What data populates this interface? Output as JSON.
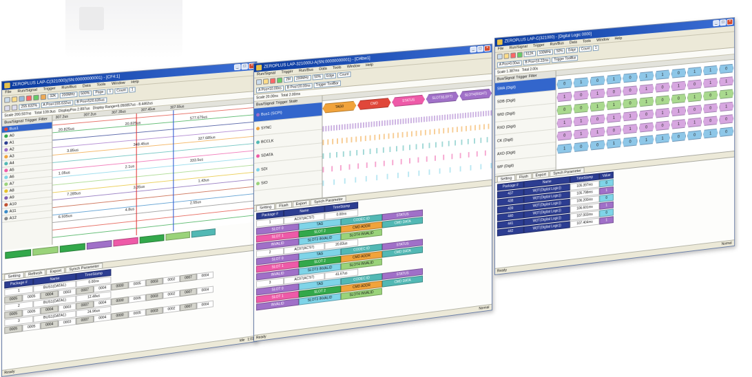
{
  "colors": {
    "title_bar": "#0a3a9e",
    "navy": "#2c3d91",
    "green": "#33a84b",
    "pink": "#ee5aa8",
    "purple": "#a070c8",
    "cyan": "#7fd4e8",
    "teal": "#52b8b4",
    "orange": "#f1a33b"
  },
  "window1": {
    "title": "ZEROPLUS LAP-C(321000)(SN:00000000001) - [CF4:1]",
    "menu": [
      "File",
      "Run/Signal",
      "Trigger",
      "Run/Bus",
      "Data",
      "Tools",
      "Window",
      "Help"
    ],
    "toolbar": {
      "memory": "32K",
      "clock": "200MHz",
      "zoom": "500%",
      "scale": "255.632%",
      "page": "Page",
      "page_value": "1",
      "count": "Count",
      "count_value": "1"
    },
    "info": {
      "scale": "Scale 200.937ns",
      "total": "Total 109.9us",
      "a_pos": "A Pos=155.632us",
      "b_pos": "B Pos=520.635us",
      "disp_pos": "DisplayPos 2.897us",
      "disp_range": "Display Range=6.050857us - 8.4462us"
    },
    "columns": {
      "bus_signal": "Bus/Signal",
      "trigger": "Trigger",
      "filter": "Filter"
    },
    "signals": [
      "Bus1",
      "A0",
      "A1",
      "A2",
      "A3",
      "A4",
      "A5",
      "A6",
      "A7",
      "A8",
      "A9",
      "A10",
      "A11",
      "A12"
    ],
    "timeline": [
      "307.2us",
      "307.2us",
      "307.35us",
      "307.45us",
      "307.55us"
    ],
    "measurements": [
      "20.825us",
      "20.825us",
      "577.675us",
      "3.85us",
      "348.45us",
      "327.685us",
      "1.05us",
      "2.1us",
      "333.5us",
      "7.285us",
      "3.35us",
      "1.43us",
      "6.935us",
      "4.8us",
      "2.55us"
    ],
    "tabs": [
      "Setting",
      "Refresh",
      "Export",
      "Synch Parameter"
    ],
    "packet_headers": [
      "Package #",
      "Name",
      "TimeStamp"
    ],
    "packets": [
      {
        "num": "1",
        "name": "BUS1(DATA1)",
        "ts": "0.00ns"
      },
      {
        "num": "2",
        "name": "BUS1(DATA1)",
        "ts": "12.48us"
      },
      {
        "num": "3",
        "name": "BUS1(DATA1)",
        "ts": "24.96us"
      }
    ],
    "data_cells": [
      "0005",
      "0005",
      "0004",
      "0003",
      "0007",
      "0004",
      "0000",
      "0005",
      "0003",
      "0002",
      "0007",
      "0004"
    ],
    "status": {
      "left": "Ready",
      "right": "1:01",
      "idle": "Idle"
    }
  },
  "window2": {
    "title": "ZEROPLUS LAP-321000U-A(SN:00000000001) - [Cl4bw1]",
    "menu": [
      "Run/Signal",
      "Trigger",
      "Run/Bus",
      "Data",
      "Tools",
      "Window",
      "Help"
    ],
    "toolbar": {
      "memory": "2M",
      "clock": "200MHz",
      "zoom": "50%",
      "edge": "Edge",
      "count": "Count"
    },
    "info": {
      "scale": "Scale 20.00ns",
      "total": "Total 2.00ms",
      "a_pos": "A Pos=10.00ns",
      "b_pos": "B Pos=20.00ns",
      "toolbar_label": "Trigger ToolBar"
    },
    "columns": {
      "bus_signal": "Bus/Signal",
      "trigger": "Trigger",
      "state": "State"
    },
    "signals": [
      "Bus1 (SCPI)",
      "SYNC",
      "BCCLK",
      "SDATA",
      "SDI",
      "SIO"
    ],
    "bus_labels": [
      "TAG0",
      "CMD",
      "STATUS",
      "SLOT3(LEFT)",
      "SLOT4(RIGHT)"
    ],
    "tabs": [
      "Setting",
      "Flush",
      "Export",
      "Synch Parameter"
    ],
    "packet_headers": [
      "Package #",
      "Name",
      "TimeStamp"
    ],
    "packet_tags": [
      "SLOT 0",
      "TAG",
      "CODEC ID",
      "STATUS",
      "SLOT 1",
      "SLOT 2",
      "CMD ADDR",
      "CMD DATA",
      "INVALID",
      "SLOT3 INVALID",
      "SLOT4 INVALID"
    ],
    "packets": [
      {
        "num": "1",
        "name": "AC97(AC'97)",
        "ts": "0.00ns"
      },
      {
        "num": "2",
        "name": "AC97(AC'97)",
        "ts": "20.83us"
      },
      {
        "num": "3",
        "name": "AC97(AC'97)",
        "ts": "41.67us"
      }
    ],
    "status": {
      "left": "Ready",
      "right": "Normal"
    }
  },
  "window3": {
    "title": "ZEROPLUS LAP-C(321000) - [Digital Logic 0000]",
    "menu": [
      "File",
      "Run/Signal",
      "Trigger",
      "Run/Bus",
      "Data",
      "Tools",
      "Window",
      "Help"
    ],
    "toolbar": {
      "memory": "512K",
      "clock": "100MHz",
      "zoom": "50%",
      "edge": "Edge",
      "count": "Count",
      "count_value": "1"
    },
    "info": {
      "scale": "Scale 1.387ms",
      "total": "Total 2.00s",
      "a_pos": "A Pos=0.00us",
      "b_pos": "B Pos=16.22ms",
      "toolbar_label": "Trigger ToolBar"
    },
    "columns": {
      "bus_signal": "Bus/Signal",
      "trigger": "Trigger",
      "filter": "Filter"
    },
    "signals": [
      "SMA (Digit)",
      "SDB (Digit)",
      "WID (Digit)",
      "RXD (Digit)",
      "CK (Digit)",
      "AXD (Digit)",
      "WP (Digit)"
    ],
    "bus_values": [
      [
        "0",
        "1",
        "0",
        "1",
        "0",
        "1",
        "1",
        "0",
        "1",
        "1",
        "0"
      ],
      [
        "1",
        "0",
        "1",
        "0",
        "0",
        "1",
        "0",
        "1",
        "0",
        "1",
        "1"
      ],
      [
        "0",
        "0",
        "1",
        "1",
        "0",
        "1",
        "0",
        "0",
        "1",
        "0",
        "1"
      ],
      [
        "1",
        "1",
        "0",
        "1",
        "1",
        "0",
        "1",
        "1",
        "0",
        "0",
        "1"
      ],
      [
        "0",
        "1",
        "1",
        "0",
        "1",
        "0",
        "0",
        "1",
        "1",
        "0",
        "0"
      ],
      [
        "1",
        "0",
        "0",
        "1",
        "0",
        "1",
        "1",
        "0",
        "0",
        "1",
        "0"
      ]
    ],
    "tabs": [
      "Setting",
      "Flush",
      "Export",
      "Synch Parameter"
    ],
    "packet_headers": [
      "Package #",
      "Name",
      "TimeStamp",
      "Value"
    ],
    "packets": [
      {
        "num": "437",
        "name": "W(IT(Digital Logic))",
        "ts": "105.397ms",
        "val": "0"
      },
      {
        "num": "438",
        "name": "W(IT(Digital Logic))",
        "ts": "105.798ms",
        "val": "1"
      },
      {
        "num": "439",
        "name": "W(IT(Digital Logic))",
        "ts": "106.200ms",
        "val": "0"
      },
      {
        "num": "440",
        "name": "W(IT(Digital Logic))",
        "ts": "106.601ms",
        "val": "1"
      },
      {
        "num": "441",
        "name": "W(IT(Digital Logic))",
        "ts": "107.003ms",
        "val": "0"
      },
      {
        "num": "442",
        "name": "W(IT(Digital Logic))",
        "ts": "107.404ms",
        "val": "1"
      }
    ],
    "status": {
      "left": "Ready",
      "right": "Normal"
    }
  }
}
